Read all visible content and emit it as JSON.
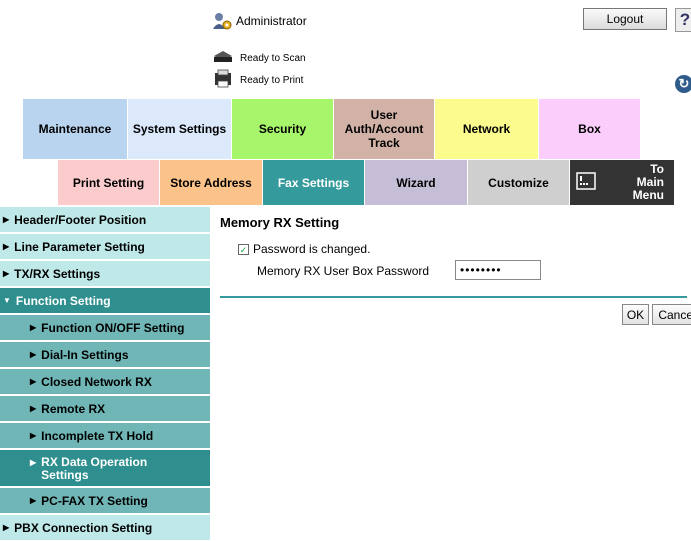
{
  "header": {
    "user_name": "Administrator",
    "logout_label": "Logout",
    "help_label": "?",
    "status_scan": "Ready to Scan",
    "status_print": "Ready to Print",
    "refresh_label": "↻"
  },
  "tabs_row1": [
    {
      "label": "Maintenance",
      "color": "#b9d4ee"
    },
    {
      "label": "System Settings",
      "color": "#dbe9fa"
    },
    {
      "label": "Security",
      "color": "#a6f56a"
    },
    {
      "label": "User Auth/Account Track",
      "color": "#d2b2a6"
    },
    {
      "label": "Network",
      "color": "#fbfb8e"
    },
    {
      "label": "Box",
      "color": "#fbcdfa"
    }
  ],
  "tabs_row2": [
    {
      "label": "Print Setting",
      "color": "#fccccd"
    },
    {
      "label": "Store Address",
      "color": "#fbc38a"
    },
    {
      "label": "Fax Settings",
      "color": "#359a9b",
      "active": true
    },
    {
      "label": "Wizard",
      "color": "#c6bdd7"
    },
    {
      "label": "Customize",
      "color": "#cfcfcf"
    },
    {
      "label": "To Main Menu",
      "color": "#333333"
    }
  ],
  "sidebar": {
    "items": [
      {
        "label": "Header/Footer Position",
        "level": 1,
        "state": "normal"
      },
      {
        "label": "Line Parameter Setting",
        "level": 1,
        "state": "normal"
      },
      {
        "label": "TX/RX Settings",
        "level": 1,
        "state": "normal"
      },
      {
        "label": "Function Setting",
        "level": 1,
        "state": "expanded"
      },
      {
        "label": "Function ON/OFF Setting",
        "level": 2,
        "state": "normal"
      },
      {
        "label": "Dial-In Settings",
        "level": 2,
        "state": "normal"
      },
      {
        "label": "Closed Network RX",
        "level": 2,
        "state": "normal"
      },
      {
        "label": "Remote RX",
        "level": 2,
        "state": "normal"
      },
      {
        "label": "Incomplete TX Hold",
        "level": 2,
        "state": "normal"
      },
      {
        "label": "RX Data Operation Settings",
        "level": 2,
        "state": "selected"
      },
      {
        "label": "PC-FAX TX Setting",
        "level": 2,
        "state": "normal"
      },
      {
        "label": "PBX Connection Setting",
        "level": 1,
        "state": "normal"
      }
    ]
  },
  "main": {
    "title": "Memory RX Setting",
    "checkbox_label": "Password is changed.",
    "checkbox_checked": true,
    "password_label": "Memory RX User Box Password",
    "password_value": "••••••••",
    "ok_label": "OK",
    "cancel_label": "Cancel"
  },
  "colors": {
    "accent": "#359a9b",
    "sidebar_level1": "#bfe8e8",
    "sidebar_level2": "#70b6b6",
    "sidebar_selected": "#2f8f8f"
  }
}
